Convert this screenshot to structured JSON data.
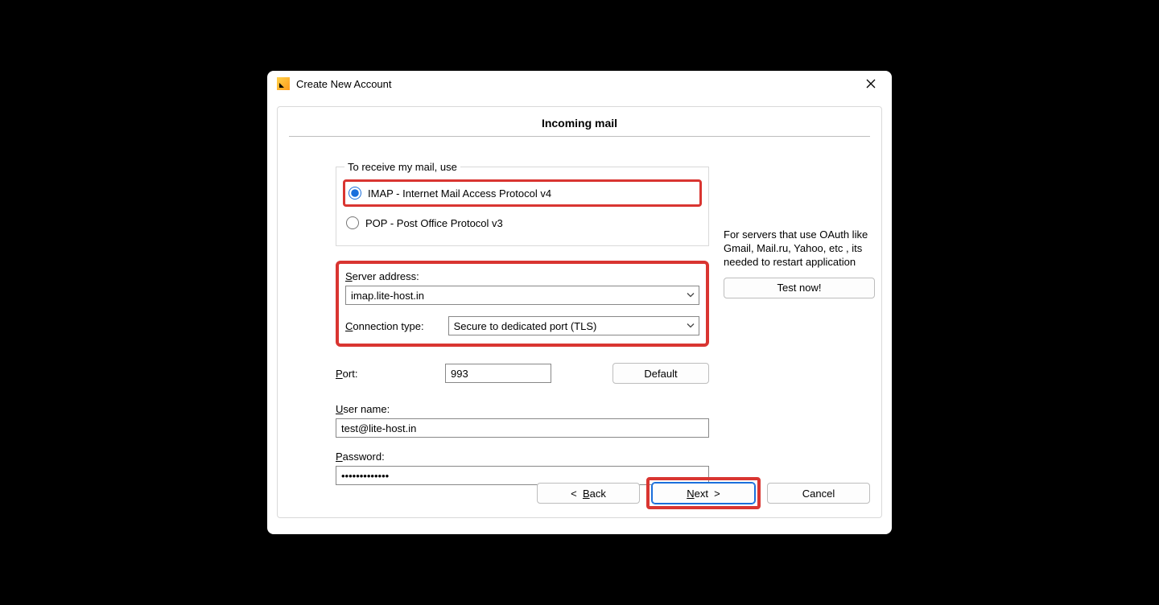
{
  "window_title": "Create New Account",
  "heading": "Incoming mail",
  "protocol_group_label": "To receive my mail, use",
  "protocols": {
    "imap": "IMAP - Internet Mail Access Protocol v4",
    "pop": "POP  -  Post Office Protocol v3"
  },
  "server_address_label": "Server address:",
  "server_address_value": "imap.lite-host.in",
  "connection_type_label": "Connection type:",
  "connection_type_value": "Secure to dedicated port (TLS)",
  "port_label": "Port:",
  "port_value": "993",
  "default_button": "Default",
  "username_label": "User name:",
  "username_value": "test@lite-host.in",
  "password_label": "Password:",
  "password_value": "•••••••••••••",
  "side_note": "For servers that use OAuth like Gmail, Mail.ru, Yahoo, etc , its needed to restart application",
  "test_button": "Test now!",
  "back_button_prefix": "<  ",
  "back_button_text": "Back",
  "next_button_text": "Next",
  "next_button_suffix": "  >",
  "cancel_button": "Cancel",
  "access_keys": {
    "server": "S",
    "connection": "C",
    "port": "P",
    "user": "U",
    "password": "P",
    "back": "B",
    "next": "N"
  }
}
